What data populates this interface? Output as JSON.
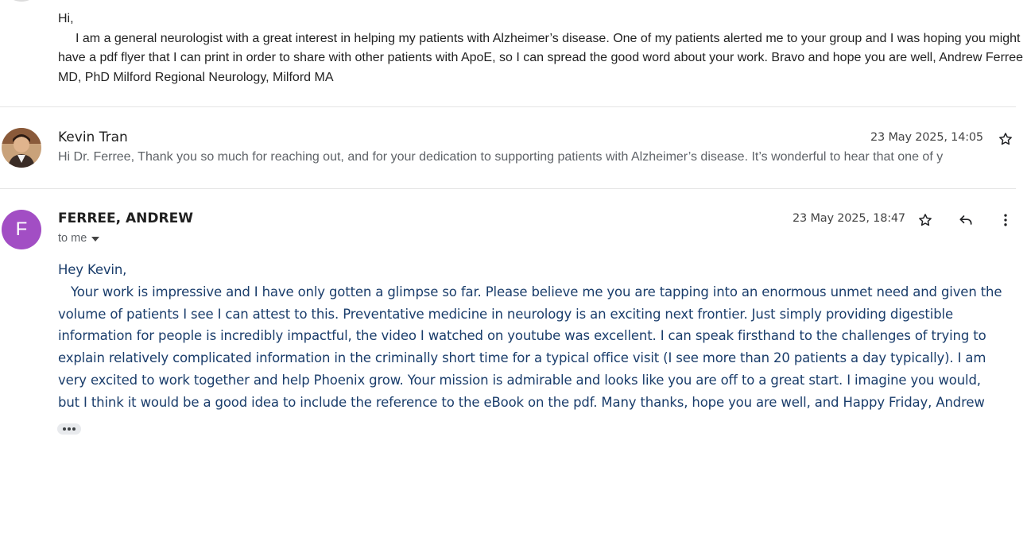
{
  "message1": {
    "greeting": "Hi,",
    "line1": "I am a general neurologist with a great interest in helping my patients with Alzheimer’s disease.   One of my patients alerted me to your group and I was hoping you might have a pdf flyer that I can print in order to share with other patients with ApoE, so I can spread the good word about your work.   Bravo and hope you are well, Andrew Ferree MD, PhD Milford Regional Neurology, Milford MA"
  },
  "message2": {
    "sender": "Kevin Tran",
    "date": "23 May 2025, 14:05",
    "snippet": "Hi Dr. Ferree, Thank you so much for reaching out, and for your dedication to supporting patients with Alzheimer’s disease. It’s wonderful to hear that one of y"
  },
  "message3": {
    "avatar_letter": "F",
    "avatar_color": "#a24ec4",
    "sender": "FERREE, ANDREW",
    "date": "23 May 2025, 18:47",
    "recipient": "to me",
    "greeting": "Hey Kevin,",
    "body": "Your work is impressive and I have only gotten a glimpse so far.   Please believe me you are tapping into an enormous unmet need and given the volume of patients I see I can attest to this.   Preventative medicine in neurology is an exciting next frontier.    Just simply providing digestible information for people is incredibly impactful, the video I watched on youtube was excellent.    I can speak firsthand to the challenges of trying to explain relatively complicated information in the criminally short time for a typical office visit (I see more than 20 patients a day typically).   I am very excited to work together and help Phoenix grow.    Your mission is admirable and looks like you are off to a great start.   I imagine you would, but I think it would be a good idea to  include the reference to the eBook on the pdf.   Many thanks, hope you are well, and Happy Friday, Andrew"
  },
  "icons": {
    "star": "star-icon",
    "reply": "reply-icon",
    "more": "more-vert-icon",
    "expand": "more-horiz-icon",
    "dropdown": "caret-down-icon"
  }
}
